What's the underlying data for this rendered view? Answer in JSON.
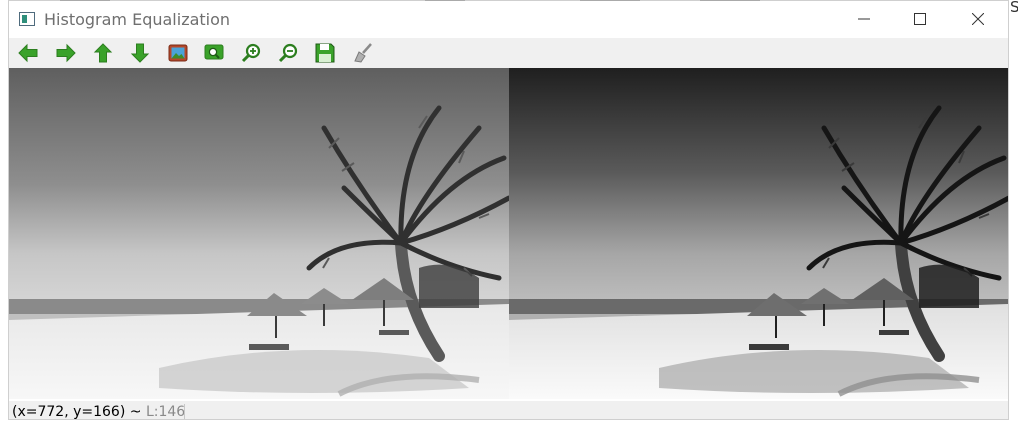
{
  "window": {
    "title": "Histogram Equalization"
  },
  "toolbar": {
    "tools": [
      {
        "icon": "arrow-left-icon",
        "label": "Previous"
      },
      {
        "icon": "arrow-right-icon",
        "label": "Next"
      },
      {
        "icon": "arrow-up-icon",
        "label": "Up"
      },
      {
        "icon": "arrow-down-icon",
        "label": "Down"
      },
      {
        "icon": "image-icon",
        "label": "Image"
      },
      {
        "icon": "zoom-fit-icon",
        "label": "Fit"
      },
      {
        "icon": "zoom-in-icon",
        "label": "Zoom in"
      },
      {
        "icon": "zoom-out-icon",
        "label": "Zoom out"
      },
      {
        "icon": "save-icon",
        "label": "Save"
      },
      {
        "icon": "clear-brush-icon",
        "label": "Clear"
      }
    ]
  },
  "status": {
    "coords": "(x=772, y=166) ~ ",
    "intensity": "L:146"
  },
  "edge_text": "S",
  "colors": {
    "toolbar_green": "#3aa22a",
    "status_gray": "#8a8a8a"
  }
}
